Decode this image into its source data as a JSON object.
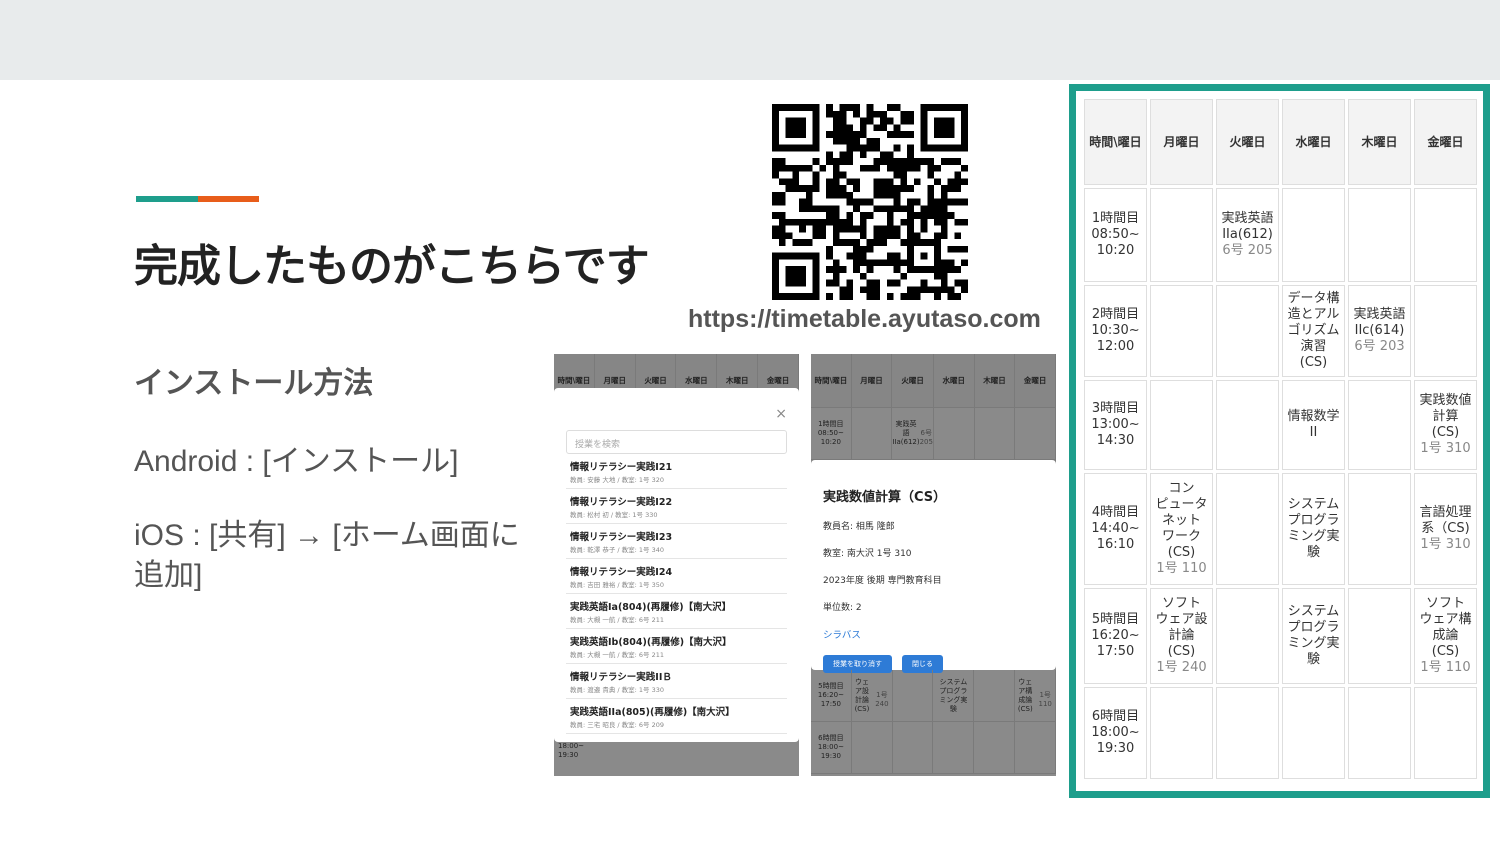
{
  "slide": {
    "title": "完成したものがこちらです",
    "subtitle": "インストール方法",
    "android": "Android : [インストール]",
    "ios": "iOS : [共有] → [ホーム画面に追加]",
    "url": "https://timetable.ayutaso.com",
    "accent_colors": [
      "#1e9e8c",
      "#e85d1a"
    ]
  },
  "qr": {
    "icon": "qr-code"
  },
  "screenshot_list": {
    "header": [
      "時間\\曜日",
      "月曜日",
      "火曜日",
      "水曜日",
      "木曜日",
      "金曜日"
    ],
    "bottom_rows": [
      [
        "",
        "",
        "",
        "",
        "",
        ""
      ]
    ],
    "search_placeholder": "授業を検索",
    "close": "×",
    "courses": [
      {
        "name": "情報リテラシー実践I21",
        "meta": "教員: 安藤 大地 / 教室: 1号 320"
      },
      {
        "name": "情報リテラシー実践I22",
        "meta": "教員: 松村 初 / 教室: 1号 330"
      },
      {
        "name": "情報リテラシー実践I23",
        "meta": "教員: 乾澤 恭子 / 教室: 1号 340"
      },
      {
        "name": "情報リテラシー実践I24",
        "meta": "教員: 吉田 雅裕 / 教室: 1号 350"
      },
      {
        "name": "実践英語Ia(804)(再履修)【南大沢】",
        "meta": "教員: 大槻 一航 / 教室: 6号 211"
      },
      {
        "name": "実践英語Ib(804)(再履修)【南大沢】",
        "meta": "教員: 大槻 一航 / 教室: 6号 211"
      },
      {
        "name": "情報リテラシー実践IIＢ",
        "meta": "教員: 渡邉 貴典 / 教室: 1号 330"
      },
      {
        "name": "実践英語IIa(805)(再履修)【南大沢】",
        "meta": "教員: 三宅 昭良 / 教室: 6号 209"
      }
    ],
    "bottom_time": "18:00~\n19:30"
  },
  "screenshot_detail": {
    "header": [
      "時間\\曜日",
      "月曜日",
      "火曜日",
      "水曜日",
      "木曜日",
      "金曜日"
    ],
    "row1": [
      {
        "t": "1時間目\n08:50~\n10:20"
      },
      {
        "t": ""
      },
      {
        "t": "実践英語\nIIa(612)",
        "r": "6号 205"
      },
      {
        "t": ""
      },
      {
        "t": ""
      },
      {
        "t": ""
      }
    ],
    "row5": [
      {
        "t": "5時間目\n16:20~\n17:50"
      },
      {
        "t": "ウェア設\n計論\n(CS)",
        "r": "1号 240"
      },
      {
        "t": ""
      },
      {
        "t": "システム\nプログラ\nミング実\n験"
      },
      {
        "t": ""
      },
      {
        "t": "ウェア構\n成論\n(CS)",
        "r": "1号 110"
      }
    ],
    "row6": [
      {
        "t": "6時間目\n18:00~\n19:30"
      },
      {
        "t": ""
      },
      {
        "t": ""
      },
      {
        "t": ""
      },
      {
        "t": ""
      },
      {
        "t": ""
      }
    ],
    "title": "実践数値計算（CS）",
    "teacher": "教員名: 相馬 隆郎",
    "room": "教室: 南大沢 1号 310",
    "term": "2023年度 後期 専門教育科目",
    "credits": "単位数: 2",
    "syllabus": "シラバス",
    "remove_btn": "授業を取り消す",
    "close_btn": "閉じる"
  },
  "timetable": {
    "header": [
      "時間\\曜日",
      "月曜日",
      "火曜日",
      "水曜日",
      "木曜日",
      "金曜日"
    ],
    "rows": [
      [
        {
          "n": "1時間目\n08:50~\n10:20"
        },
        {
          "n": ""
        },
        {
          "n": "実践英語\nIIa(612)",
          "r": "6号 205"
        },
        {
          "n": ""
        },
        {
          "n": ""
        },
        {
          "n": ""
        }
      ],
      [
        {
          "n": "2時間目\n10:30~\n12:00"
        },
        {
          "n": ""
        },
        {
          "n": ""
        },
        {
          "n": "データ構\n造とアル\nゴリズム\n演習\n(CS)"
        },
        {
          "n": "実践英語\nIIc(614)",
          "r": "6号 203"
        },
        {
          "n": ""
        }
      ],
      [
        {
          "n": "3時間目\n13:00~\n14:30"
        },
        {
          "n": ""
        },
        {
          "n": ""
        },
        {
          "n": "情報数学\nII"
        },
        {
          "n": ""
        },
        {
          "n": "実践数値\n計算\n(CS)",
          "r": "1号 310"
        }
      ],
      [
        {
          "n": "4時間目\n14:40~\n16:10"
        },
        {
          "n": "コン\nピュータ\nネット\nワーク\n(CS)",
          "r": "1号 110"
        },
        {
          "n": ""
        },
        {
          "n": "システム\nプログラ\nミング実\n験"
        },
        {
          "n": ""
        },
        {
          "n": "言語処理\n系（CS)",
          "r": "1号 310"
        }
      ],
      [
        {
          "n": "5時間目\n16:20~\n17:50"
        },
        {
          "n": "ソフト\nウェア設\n計論\n(CS)",
          "r": "1号 240"
        },
        {
          "n": ""
        },
        {
          "n": "システム\nプログラ\nミング実\n験"
        },
        {
          "n": ""
        },
        {
          "n": "ソフト\nウェア構\n成論\n(CS)",
          "r": "1号 110"
        }
      ],
      [
        {
          "n": "6時間目\n18:00~\n19:30"
        },
        {
          "n": ""
        },
        {
          "n": ""
        },
        {
          "n": ""
        },
        {
          "n": ""
        },
        {
          "n": ""
        }
      ]
    ],
    "frame_color": "#1e9e8c"
  }
}
